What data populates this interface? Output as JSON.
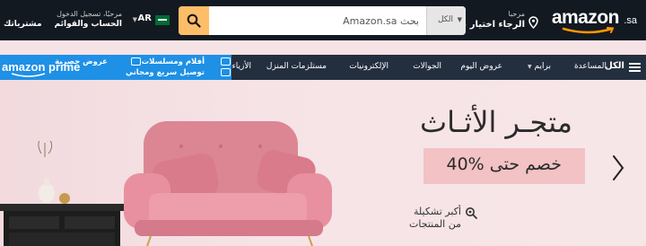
{
  "header": {
    "logo_text": "amazon",
    "logo_tld": ".sa",
    "deliver": {
      "line1": "مرحبا",
      "line2": "الرجاء اختيار عنوانك"
    },
    "search": {
      "category": "الكل",
      "placeholder": "بحث Amazon.sa"
    },
    "language": {
      "code": "AR"
    },
    "account": {
      "line1": "مرحبًا، تسجيل الدخول",
      "line2": "الحساب والقوائم"
    },
    "orders": "مشترياتك"
  },
  "nav": {
    "all_label": "الكل",
    "items": [
      "المساعدة",
      "برايم",
      "عروض اليوم",
      "الجوالات",
      "الإلكترونيات",
      "مستلزمات المنزل",
      "الأزياء"
    ],
    "prime": {
      "logo_text": "amazon prime",
      "feature1_line1": "أفلام ومسلسلات",
      "feature1_line2": "توصيل سريع ومجاني",
      "feature2_line1": "عروض حصرية"
    }
  },
  "hero": {
    "title": "متجـر الأثـاث",
    "discount": "خصم حتى %40",
    "explore_line1": "أكبر تشكيلة",
    "explore_line2": "من المنتجات"
  },
  "colors": {
    "topbar_bg": "#131921",
    "navbar_bg": "#232f3e",
    "search_button": "#febd69",
    "prime_bg": "#1e90e6",
    "hero_bg": "#f6e3e6",
    "discount_bg": "#f2c2c4",
    "sofa": "#e58c9b"
  },
  "icons": {
    "location": "location-pin-icon",
    "search": "search-icon",
    "menu": "hamburger-menu-icon",
    "next": "chevron-right-icon",
    "explore": "magnifier-icon"
  }
}
